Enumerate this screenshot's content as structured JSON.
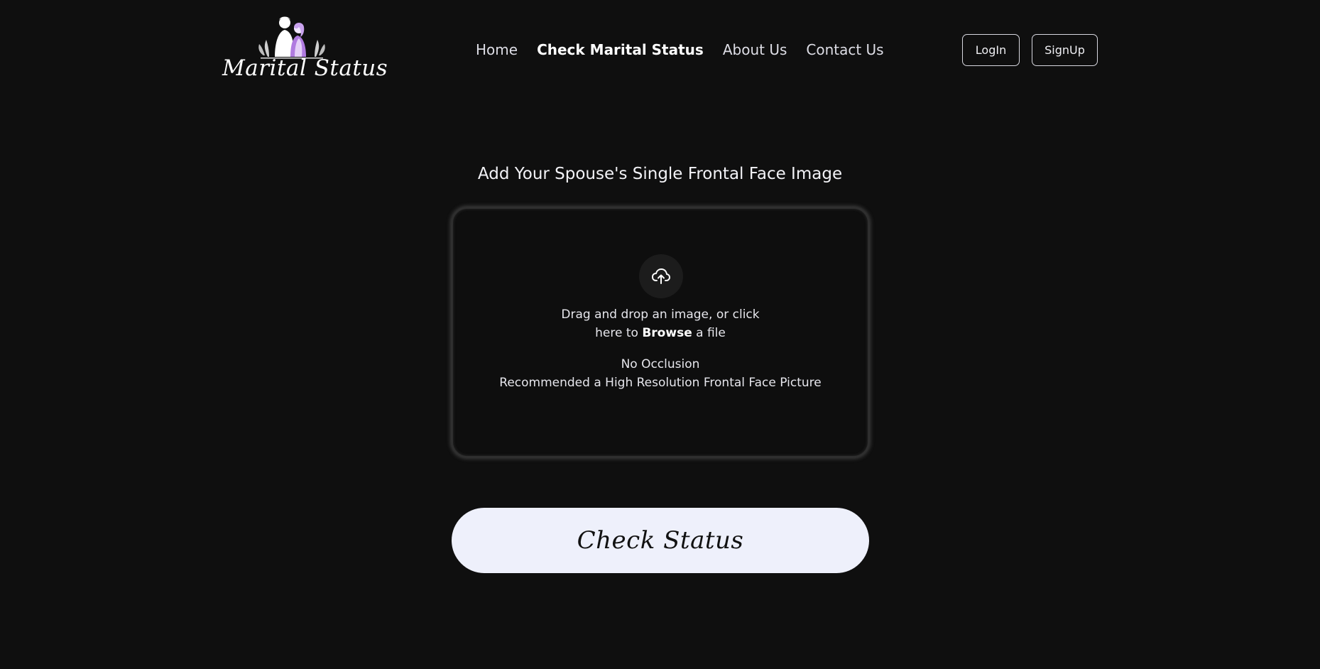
{
  "brand": {
    "name": "Marital Status",
    "logo_icon": "couple-silhouette-icon"
  },
  "nav": {
    "items": [
      {
        "label": "Home",
        "active": false
      },
      {
        "label": "Check Marital Status",
        "active": true
      },
      {
        "label": "About Us",
        "active": false
      },
      {
        "label": "Contact Us",
        "active": false
      }
    ]
  },
  "auth": {
    "login_label": "LogIn",
    "signup_label": "SignUp"
  },
  "upload": {
    "heading": "Add Your Spouse's Single Frontal Face Image",
    "icon": "cloud-upload-icon",
    "line1": "Drag and drop an image, or click",
    "line2_prefix": "here to",
    "line2_link": "Browse",
    "line2_suffix": "a file",
    "hint1": "No Occlusion",
    "hint2": "Recommended a High Resolution Frontal Face Picture"
  },
  "actions": {
    "check_label": "Check Status"
  },
  "colors": {
    "background": "#0f0f0f",
    "button_bg": "#eef0fb",
    "accent_purple": "#b07be0"
  }
}
